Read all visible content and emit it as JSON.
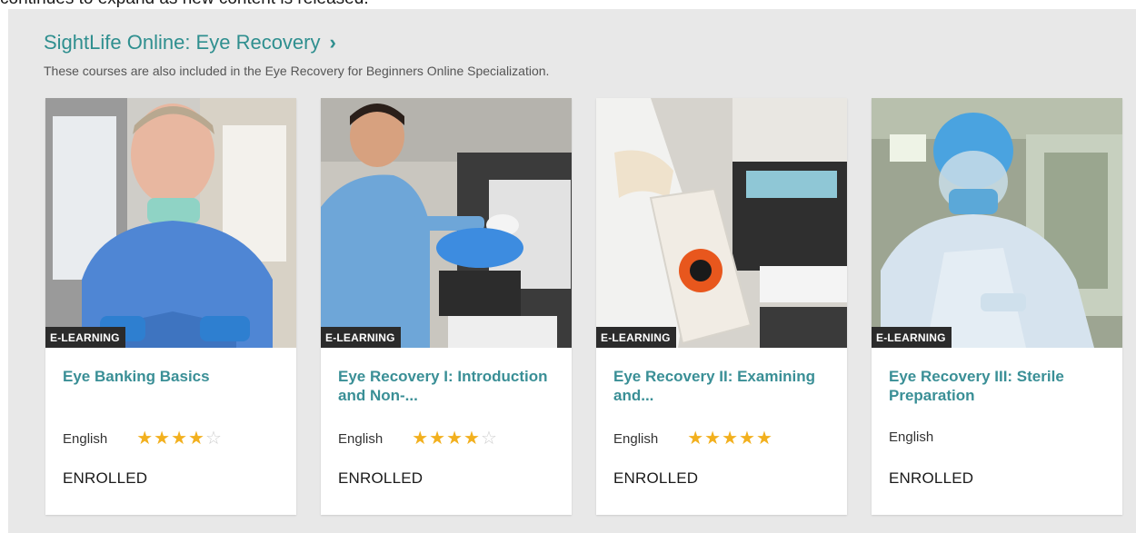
{
  "page": {
    "top_text": "continues to expand as new content is released."
  },
  "section": {
    "title": "SightLife Online: Eye Recovery",
    "chevron": "›",
    "subtitle": "These courses are also included in the Eye Recovery for Beginners Online Specialization."
  },
  "cards": [
    {
      "badge": "E-LEARNING",
      "title": "Eye Banking Basics",
      "language": "English",
      "rating": 4,
      "rating_max": 5,
      "status": "ENROLLED",
      "image": "instructor-portrait-photo"
    },
    {
      "badge": "E-LEARNING",
      "title": "Eye Recovery I: Introduction and Non-...",
      "language": "English",
      "rating": 4,
      "rating_max": 5,
      "status": "ENROLLED",
      "image": "technician-packing-photo"
    },
    {
      "badge": "E-LEARNING",
      "title": "Eye Recovery II: Examining and...",
      "language": "English",
      "rating": 5,
      "rating_max": 5,
      "status": "ENROLLED",
      "image": "biohazard-bag-photo"
    },
    {
      "badge": "E-LEARNING",
      "title": "Eye Recovery III: Sterile Preparation",
      "language": "English",
      "rating": null,
      "rating_max": 5,
      "status": "ENROLLED",
      "image": "sterile-gown-photo"
    }
  ],
  "colors": {
    "accent": "#2f8f8f",
    "star": "#f2b01e",
    "badge_bg": "#2b2b2b",
    "section_bg": "#e8e8e8"
  }
}
